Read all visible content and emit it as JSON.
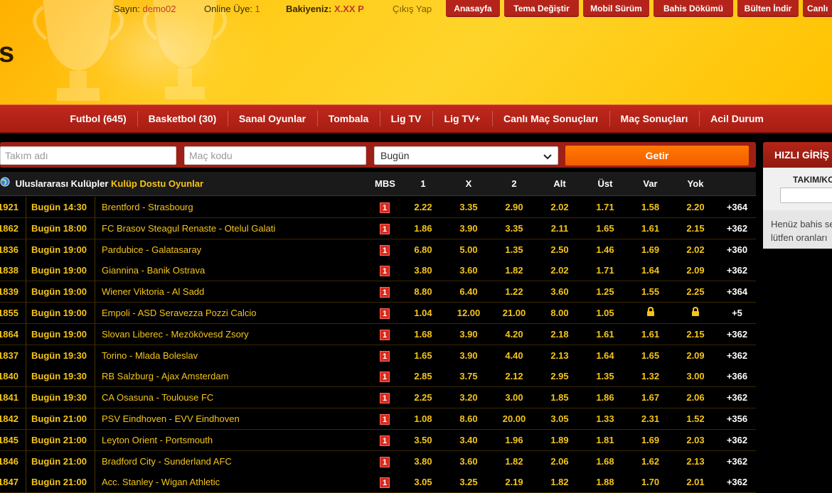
{
  "topbar": {
    "greeting_label": "Sayın:",
    "username": "demo02",
    "online_label": "Online Üye:",
    "online_count": "1",
    "balance_label": "Bakiyeniz:",
    "balance_value": "X.XX P",
    "logout": "Çıkış Yap",
    "buttons": [
      "Anasayfa",
      "Tema Değiştir",
      "Mobil Sürüm",
      "Bahis Dökümü",
      "Bülten İndir",
      "Canlı"
    ]
  },
  "logo_text": "s",
  "sportnav": [
    "Futbol (645)",
    "Basketbol (30)",
    "Sanal Oyunlar",
    "Tombala",
    "Lig TV",
    "Lig TV+",
    "Canlı Maç Sonuçları",
    "Maç Sonuçları",
    "Acil Durum"
  ],
  "search": {
    "team_placeholder": "Takım adı",
    "code_placeholder": "Maç kodu",
    "date_selected": "Bugün",
    "submit": "Getir"
  },
  "table": {
    "league": "Uluslararası Kulüpler",
    "league_sub": "Kulüp Dostu Oyunlar",
    "headers": [
      "MBS",
      "1",
      "X",
      "2",
      "Alt",
      "Üst",
      "Var",
      "Yok"
    ],
    "rows": [
      {
        "code": "1921",
        "time": "Bugün 14:30",
        "match": "Brentford - Strasbourg",
        "mbs": "1",
        "o1": "2.22",
        "ox": "3.35",
        "o2": "2.90",
        "alt": "2.02",
        "ust": "1.71",
        "var": "1.58",
        "yok": "2.20",
        "more": "+364"
      },
      {
        "code": "1862",
        "time": "Bugün 18:00",
        "match": "FC Brasov Steagul Renaste - Otelul Galati",
        "mbs": "1",
        "o1": "1.86",
        "ox": "3.90",
        "o2": "3.35",
        "alt": "2.11",
        "ust": "1.65",
        "var": "1.61",
        "yok": "2.15",
        "more": "+362"
      },
      {
        "code": "1836",
        "time": "Bugün 19:00",
        "match": "Pardubice - Galatasaray",
        "mbs": "1",
        "o1": "6.80",
        "ox": "5.00",
        "o2": "1.35",
        "alt": "2.50",
        "ust": "1.46",
        "var": "1.69",
        "yok": "2.02",
        "more": "+360"
      },
      {
        "code": "1838",
        "time": "Bugün 19:00",
        "match": "Giannina - Banik Ostrava",
        "mbs": "1",
        "o1": "3.80",
        "ox": "3.60",
        "o2": "1.82",
        "alt": "2.02",
        "ust": "1.71",
        "var": "1.64",
        "yok": "2.09",
        "more": "+362"
      },
      {
        "code": "1839",
        "time": "Bugün 19:00",
        "match": "Wiener Viktoria - Al Sadd",
        "mbs": "1",
        "o1": "8.80",
        "ox": "6.40",
        "o2": "1.22",
        "alt": "3.60",
        "ust": "1.25",
        "var": "1.55",
        "yok": "2.25",
        "more": "+364"
      },
      {
        "code": "1855",
        "time": "Bugün 19:00",
        "match": "Empoli - ASD Seravezza Pozzi Calcio",
        "mbs": "1",
        "o1": "1.04",
        "ox": "12.00",
        "o2": "21.00",
        "alt": "8.00",
        "ust": "1.05",
        "var": "lock",
        "yok": "lock",
        "more": "+5"
      },
      {
        "code": "1864",
        "time": "Bugün 19:00",
        "match": "Slovan Liberec - Mezökövesd Zsory",
        "mbs": "1",
        "o1": "1.68",
        "ox": "3.90",
        "o2": "4.20",
        "alt": "2.18",
        "ust": "1.61",
        "var": "1.61",
        "yok": "2.15",
        "more": "+362"
      },
      {
        "code": "1837",
        "time": "Bugün 19:30",
        "match": "Torino - Mlada Boleslav",
        "mbs": "1",
        "o1": "1.65",
        "ox": "3.90",
        "o2": "4.40",
        "alt": "2.13",
        "ust": "1.64",
        "var": "1.65",
        "yok": "2.09",
        "more": "+362"
      },
      {
        "code": "1840",
        "time": "Bugün 19:30",
        "match": "RB Salzburg - Ajax Amsterdam",
        "mbs": "1",
        "o1": "2.85",
        "ox": "3.75",
        "o2": "2.12",
        "alt": "2.95",
        "ust": "1.35",
        "var": "1.32",
        "yok": "3.00",
        "more": "+366"
      },
      {
        "code": "1841",
        "time": "Bugün 19:30",
        "match": "CA Osasuna - Toulouse FC",
        "mbs": "1",
        "o1": "2.25",
        "ox": "3.20",
        "o2": "3.00",
        "alt": "1.85",
        "ust": "1.86",
        "var": "1.67",
        "yok": "2.06",
        "more": "+362"
      },
      {
        "code": "1842",
        "time": "Bugün 21:00",
        "match": "PSV Eindhoven - EVV Eindhoven",
        "mbs": "1",
        "o1": "1.08",
        "ox": "8.60",
        "o2": "20.00",
        "alt": "3.05",
        "ust": "1.33",
        "var": "2.31",
        "yok": "1.52",
        "more": "+356"
      },
      {
        "code": "1845",
        "time": "Bugün 21:00",
        "match": "Leyton Orient - Portsmouth",
        "mbs": "1",
        "o1": "3.50",
        "ox": "3.40",
        "o2": "1.96",
        "alt": "1.89",
        "ust": "1.81",
        "var": "1.69",
        "yok": "2.03",
        "more": "+362"
      },
      {
        "code": "1846",
        "time": "Bugün 21:00",
        "match": "Bradford City - Sunderland AFC",
        "mbs": "1",
        "o1": "3.80",
        "ox": "3.60",
        "o2": "1.82",
        "alt": "2.06",
        "ust": "1.68",
        "var": "1.62",
        "yok": "2.13",
        "more": "+362"
      },
      {
        "code": "1847",
        "time": "Bugün 21:00",
        "match": "Acc. Stanley - Wigan Athletic",
        "mbs": "1",
        "o1": "3.05",
        "ox": "3.25",
        "o2": "2.19",
        "alt": "1.82",
        "ust": "1.88",
        "var": "1.70",
        "yok": "2.01",
        "more": "+362"
      }
    ]
  },
  "quick_panel": {
    "title": "HIZLI GİRİŞ",
    "label": "TAKIM/KOD",
    "msg_line1": "Henüz bahis seçmediniz,",
    "msg_line2": "lütfen oranları"
  },
  "colors": {
    "accent": "#f5c518",
    "nav_red": "#b4241a",
    "button_orange": "#ff7a00"
  }
}
